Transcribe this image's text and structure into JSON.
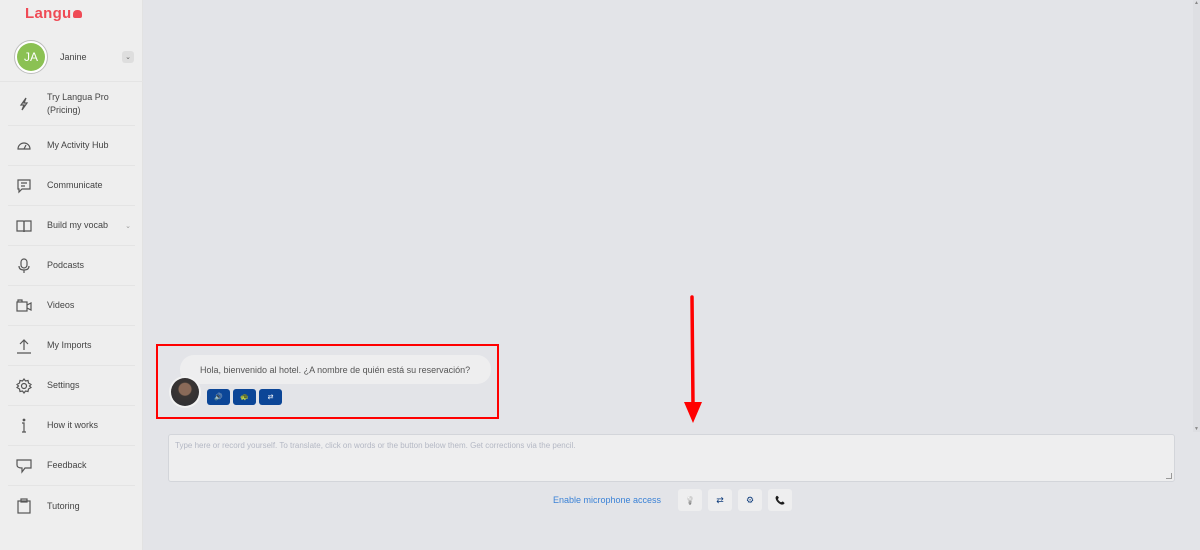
{
  "app": {
    "logo_text": "Langu",
    "brand_color": "#ef4a55"
  },
  "user": {
    "initials": "JA",
    "name": "Janine",
    "chevron": "⌄"
  },
  "sidebar": {
    "items": [
      {
        "label": "Try Langua Pro (Pricing)",
        "icon": "lightning-icon"
      },
      {
        "label": "My Activity Hub",
        "icon": "dashboard-gauge-icon"
      },
      {
        "label": "Communicate",
        "icon": "chat-message-icon"
      },
      {
        "label": "Build my vocab",
        "icon": "book-icon",
        "has_submenu": true
      },
      {
        "label": "Podcasts",
        "icon": "microphone-icon"
      },
      {
        "label": "Videos",
        "icon": "video-camera-icon"
      },
      {
        "label": "My Imports",
        "icon": "upload-icon"
      },
      {
        "label": "Settings",
        "icon": "gear-icon"
      },
      {
        "label": "How it works",
        "icon": "info-icon"
      },
      {
        "label": "Feedback",
        "icon": "feedback-bubble-icon"
      },
      {
        "label": "Tutoring",
        "icon": "clipboard-icon"
      }
    ],
    "submenu_chevron": "⌄"
  },
  "chat": {
    "messages": [
      {
        "sender": "bot",
        "text": "Hola, bienvenido al hotel. ¿A nombre de quién está su reservación?",
        "buttons": [
          {
            "name": "play-audio-button",
            "icon": "🔊"
          },
          {
            "name": "slow-audio-button",
            "icon": "🐢"
          },
          {
            "name": "translate-button",
            "icon": "⇄"
          }
        ]
      }
    ]
  },
  "composer": {
    "placeholder": "Type here or record yourself. To translate, click on words or the button below them. Get corrections via the pencil.",
    "value": ""
  },
  "bottom_bar": {
    "mic_link": "Enable microphone access",
    "tools": [
      {
        "name": "hint-button",
        "icon": "💡"
      },
      {
        "name": "translate-button",
        "icon": "⇄"
      },
      {
        "name": "settings-button",
        "icon": "⚙"
      },
      {
        "name": "call-button",
        "icon": "📞"
      }
    ]
  },
  "annotations": {
    "highlight_color": "#ff0000"
  }
}
